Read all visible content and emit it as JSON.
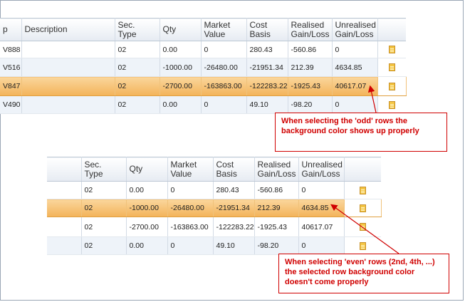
{
  "top_grid": {
    "columns": [
      "p",
      "Description",
      "Sec.\nType",
      "Qty",
      "Market\nValue",
      "Cost\nBasis",
      "Realised\nGain/Loss",
      "Unrealised\nGain/Loss"
    ],
    "rows": [
      {
        "id": "V888",
        "desc": "",
        "sec_type": "02",
        "qty": "0.00",
        "market_value": "0",
        "cost_basis": "280.43",
        "realised": "-560.86",
        "unrealised": "0"
      },
      {
        "id": "V516",
        "desc": "",
        "sec_type": "02",
        "qty": "-1000.00",
        "market_value": "-26480.00",
        "cost_basis": "-21951.34",
        "realised": "212.39",
        "unrealised": "4634.85"
      },
      {
        "id": "V847",
        "desc": "",
        "sec_type": "02",
        "qty": "-2700.00",
        "market_value": "-163863.00",
        "cost_basis": "-122283.22",
        "realised": "-1925.43",
        "unrealised": "40617.07"
      },
      {
        "id": "V490",
        "desc": "",
        "sec_type": "02",
        "qty": "0.00",
        "market_value": "0",
        "cost_basis": "49.10",
        "realised": "-98.20",
        "unrealised": "0"
      }
    ]
  },
  "bottom_grid": {
    "columns": [
      "Sec.\nType",
      "Qty",
      "Market\nValue",
      "Cost\nBasis",
      "Realised\nGain/Loss",
      "Unrealised\nGain/Loss"
    ],
    "rows": [
      {
        "sec_type": "02",
        "qty": "0.00",
        "market_value": "0",
        "cost_basis": "280.43",
        "realised": "-560.86",
        "unrealised": "0"
      },
      {
        "sec_type": "02",
        "qty": "-1000.00",
        "market_value": "-26480.00",
        "cost_basis": "-21951.34",
        "realised": "212.39",
        "unrealised": "4634.85"
      },
      {
        "sec_type": "02",
        "qty": "-2700.00",
        "market_value": "-163863.00",
        "cost_basis": "-122283.22",
        "realised": "-1925.43",
        "unrealised": "40617.07"
      },
      {
        "sec_type": "02",
        "qty": "0.00",
        "market_value": "0",
        "cost_basis": "49.10",
        "realised": "-98.20",
        "unrealised": "0"
      }
    ]
  },
  "callouts": {
    "top": "When selecting the 'odd' rows the background color shows up properly",
    "bottom": "When selecting 'even' rows (2nd, 4th, ...) the selected row background color doesn't come properly"
  },
  "colors": {
    "selected_row": "#f3b35a",
    "alt_row": "#eef3f9",
    "callout_red": "#d00000"
  },
  "icons": {
    "row_action": "document-icon"
  }
}
